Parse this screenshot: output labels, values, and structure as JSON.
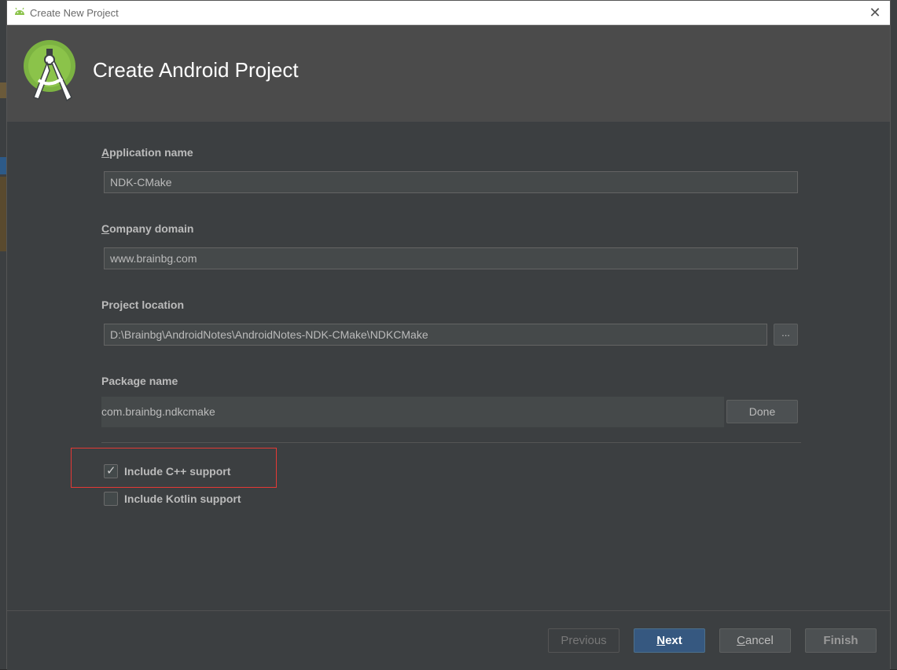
{
  "window": {
    "title": "Create New Project",
    "close_icon": "close-icon"
  },
  "header": {
    "title": "Create Android Project",
    "logo": "android-studio-logo"
  },
  "form": {
    "app_name": {
      "label_first": "A",
      "label_rest": "pplication name",
      "value": "NDK-CMake"
    },
    "company_domain": {
      "label_first": "C",
      "label_rest": "ompany domain",
      "value": "www.brainbg.com"
    },
    "project_location": {
      "label": "Project location",
      "value": "D:\\Brainbg\\AndroidNotes\\AndroidNotes-NDK-CMake\\NDKCMake",
      "browse_label": "..."
    },
    "package_name": {
      "label": "Package name",
      "value": "com.brainbg.ndkcmake",
      "done_label": "Done"
    }
  },
  "options": {
    "cpp": {
      "label": "Include C++ support",
      "checked": true
    },
    "kotlin": {
      "label": "Include Kotlin support",
      "checked": false
    }
  },
  "footer": {
    "previous": "Previous",
    "next_first": "N",
    "next_rest": "ext",
    "cancel_first": "C",
    "cancel_rest": "ancel",
    "finish": "Finish"
  },
  "colors": {
    "accent_button": "#365880",
    "highlight_box": "#e53935",
    "android_green": "#8bc34a"
  }
}
